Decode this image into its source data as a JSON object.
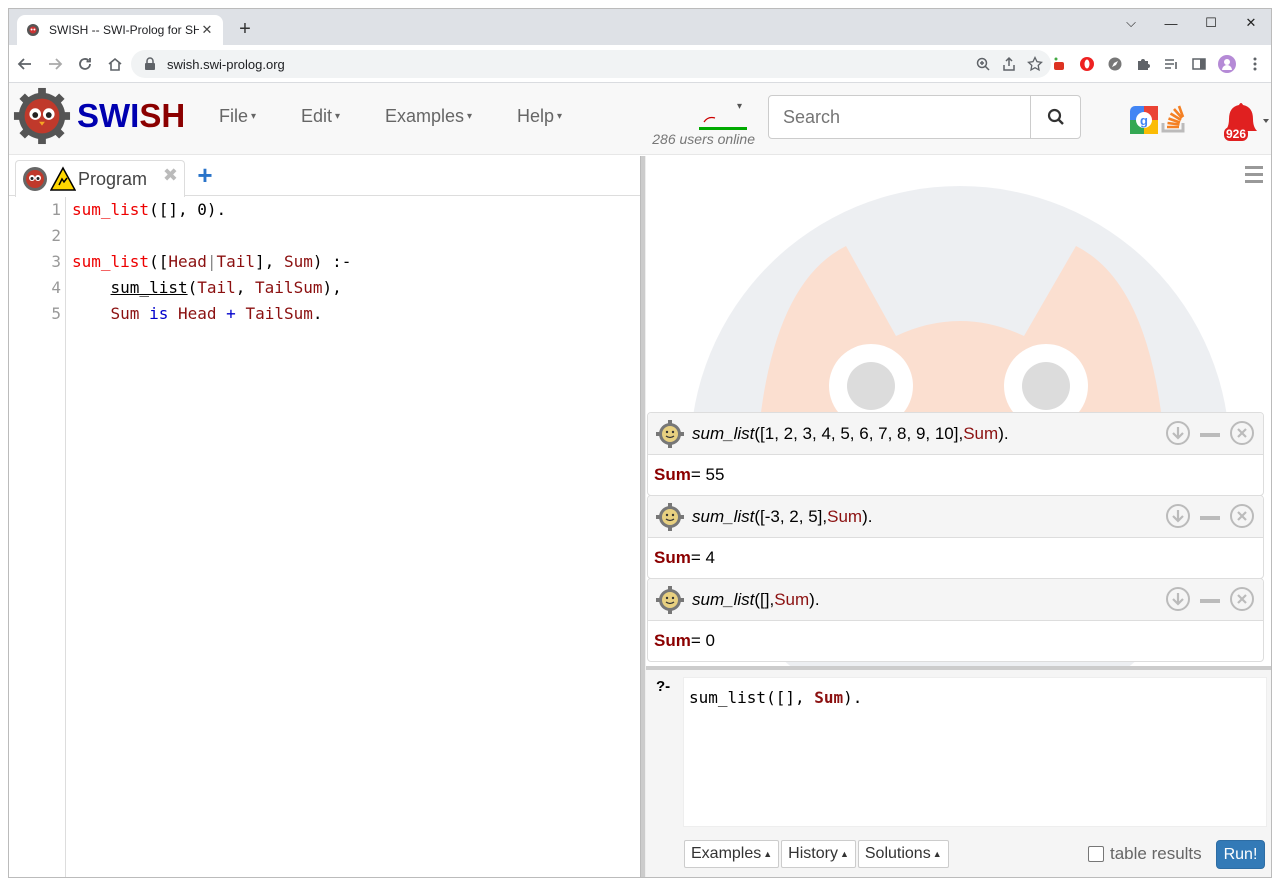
{
  "browser": {
    "tab_title": "SWISH -- SWI-Prolog for SHaring",
    "tab_close": "✕",
    "new_tab": "+",
    "url": "swish.swi-prolog.org",
    "window_controls": [
      "⌵",
      "—",
      "☐",
      "✕"
    ]
  },
  "navbar": {
    "brand_sw": "SWI",
    "brand_sh": "SH",
    "menus": [
      {
        "label": "File"
      },
      {
        "label": "Edit"
      },
      {
        "label": "Examples"
      },
      {
        "label": "Help"
      }
    ],
    "caret": "▾",
    "users_online": "286 users online",
    "search_placeholder": "Search",
    "notification_count": "926"
  },
  "editor": {
    "tab_label": "Program",
    "tab_close": "✖",
    "add_tab": "+",
    "line_numbers": [
      "1",
      "2",
      "3",
      "4",
      "5"
    ]
  },
  "answers": [
    {
      "pred": "sum_list",
      "args_open": "([1, 2, 3, 4, 5, 6, 7, 8, 9, 10], ",
      "var": "Sum",
      "close": ").",
      "result_var": "Sum",
      "result_value": " = 55"
    },
    {
      "pred": "sum_list",
      "args_open": "([-3, 2, 5], ",
      "var": "Sum",
      "close": ").",
      "result_var": "Sum",
      "result_value": " = 4"
    },
    {
      "pred": "sum_list",
      "args_open": "([], ",
      "var": "Sum",
      "close": ").",
      "result_var": "Sum",
      "result_value": " = 0"
    }
  ],
  "query": {
    "prompt": "?-",
    "text_pred": "sum_list([], ",
    "text_var": "Sum",
    "text_close": ").",
    "buttons": [
      {
        "label": "Examples"
      },
      {
        "label": "History"
      },
      {
        "label": "Solutions"
      }
    ],
    "button_caret": "▲",
    "table_results_label": "table results",
    "run_label": "Run!"
  },
  "colors": {
    "accent": "#337ab7",
    "brand_blue": "#0000b0",
    "brand_red": "#8b0000",
    "variable": "#8b1010",
    "head": "#ee0000"
  }
}
